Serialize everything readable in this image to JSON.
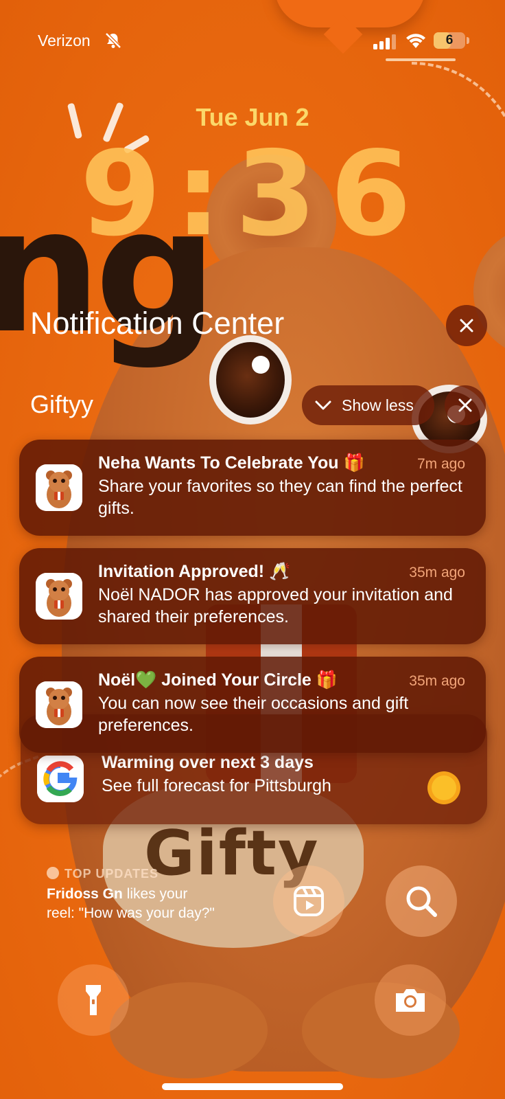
{
  "status_bar": {
    "carrier": "Verizon",
    "battery_level": "6",
    "battery_fraction": 0.06
  },
  "lock_screen": {
    "date": "Tue Jun 2",
    "time": "9:36"
  },
  "notification_center": {
    "title": "Notification Center",
    "group": {
      "app_name": "Giftyy",
      "show_less_label": "Show less"
    },
    "notifications": [
      {
        "app": "Giftyy",
        "title": "Neha Wants To Celebrate You 🎁",
        "time": "7m ago",
        "body": "Share your favorites so they can find the perfect gifts."
      },
      {
        "app": "Giftyy",
        "title": "Invitation Approved! 🥂",
        "time": "35m ago",
        "body": "Noël NADOR has approved your invitation and shared their preferences."
      },
      {
        "app": "Giftyy",
        "title": "Noël💚 Joined Your Circle 🎁",
        "time": "35m ago",
        "body": "You can now see their occasions and gift preferences."
      },
      {
        "app": "Google",
        "title": "Warming over next 3 days",
        "body": "See full forecast for Pittsburgh"
      }
    ]
  },
  "widgets": {
    "top_updates": {
      "header": "TOP UPDATES",
      "user": "Fridoss Gn",
      "text": " likes your reel: \"How was your day?\""
    }
  },
  "wallpaper_text": {
    "left_letters": "ng",
    "belly": "Gifty"
  },
  "icons": {
    "mute": "bell-slash-icon",
    "signal": "cellular-signal-icon",
    "wifi": "wifi-icon",
    "close": "close-icon",
    "chevron": "chevron-down-icon",
    "reels": "reels-icon",
    "search": "search-icon",
    "flashlight": "flashlight-icon",
    "camera": "camera-icon",
    "facebook": "facebook-icon",
    "weather": "sun-icon"
  },
  "colors": {
    "wallpaper": "#ea6a10",
    "date_text": "#fbd86a",
    "notification_bg": "#5f1905",
    "time_text": "#f2a579"
  }
}
